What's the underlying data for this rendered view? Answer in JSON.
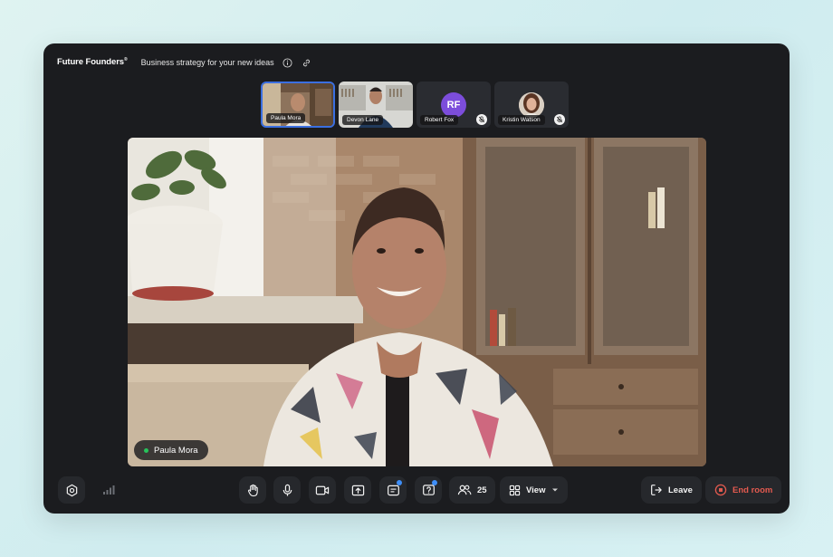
{
  "header": {
    "brand": "Future Founders",
    "brand_mark": "®",
    "title": "Business strategy for your new ideas"
  },
  "participants": [
    {
      "name": "Paula Mora",
      "active": true,
      "muted": false
    },
    {
      "name": "Devon Lane",
      "active": false,
      "muted": false
    },
    {
      "name": "Robert Fox",
      "initials": "RF",
      "active": false,
      "muted": true,
      "avatar_color": "#7c4ddb"
    },
    {
      "name": "Kristin Watson",
      "active": false,
      "muted": true
    }
  ],
  "main_speaker": {
    "name": "Paula Mora",
    "status_color": "#27c35b"
  },
  "controls": {
    "people_count": "25",
    "view_label": "View",
    "leave_label": "Leave",
    "end_label": "End room"
  },
  "colors": {
    "accent": "#3b6fe0",
    "danger": "#e35a4f",
    "notification": "#3e8ef7"
  }
}
